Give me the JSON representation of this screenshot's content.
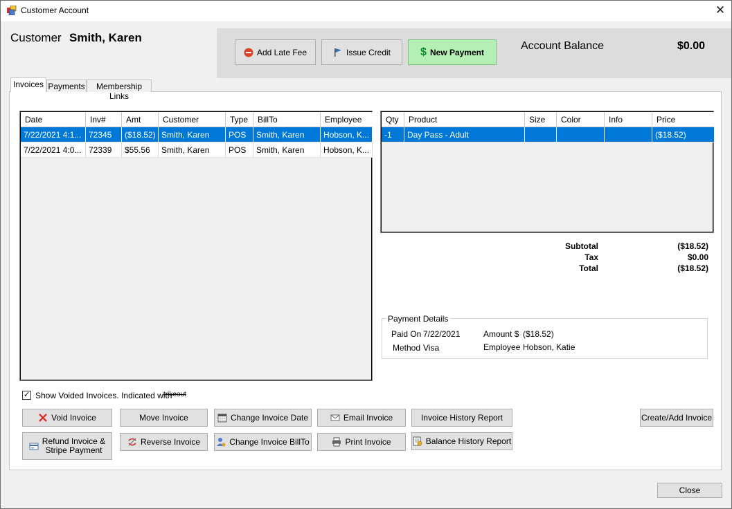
{
  "window": {
    "title": "Customer Account",
    "close_glyph": "✕"
  },
  "customer": {
    "label": "Customer",
    "name": "Smith, Karen"
  },
  "actions": {
    "add_late_fee": "Add Late Fee",
    "issue_credit": "Issue Credit",
    "new_payment": "New Payment"
  },
  "account": {
    "balance_label": "Account Balance",
    "balance_value": "$0.00"
  },
  "tabs": [
    {
      "label": "Invoices",
      "active": true
    },
    {
      "label": "Payments",
      "active": false
    },
    {
      "label": "Membership Links",
      "active": false
    }
  ],
  "invoices": {
    "columns": [
      "Date",
      "Inv#",
      "Amt",
      "Customer",
      "Type",
      "BillTo",
      "Employee"
    ],
    "rows": [
      [
        "7/22/2021 4:1...",
        "72345",
        "($18.52)",
        "Smith, Karen",
        "POS",
        "Smith, Karen",
        "Hobson, K..."
      ],
      [
        "7/22/2021 4:0...",
        "72339",
        "$55.56",
        "Smith, Karen",
        "POS",
        "Smith, Karen",
        "Hobson, K..."
      ]
    ],
    "selected_row": 0
  },
  "items": {
    "columns": [
      "Qty",
      "Product",
      "Size",
      "Color",
      "Info",
      "Price"
    ],
    "rows": [
      [
        "-1",
        "Day Pass - Adult",
        "",
        "",
        "",
        "($18.52)"
      ]
    ],
    "selected_row": 0
  },
  "totals": {
    "subtotal_label": "Subtotal",
    "subtotal": "($18.52)",
    "tax_label": "Tax",
    "tax": "$0.00",
    "total_label": "Total",
    "total": "($18.52)"
  },
  "payment_details": {
    "title": "Payment Details",
    "paid_on_label": "Paid On",
    "paid_on": "7/22/2021",
    "method_label": "Method",
    "method": "Visa",
    "amount_label": "Amount $",
    "amount": "($18.52)",
    "employee_label": "Employee",
    "employee": "Hobson, Katie"
  },
  "show_voided": {
    "checked": true,
    "label": "Show Voided Invoices. Indicated with",
    "strike_text": "trikeout"
  },
  "buttons": {
    "void_invoice": "Void Invoice",
    "refund_invoice": "Refund Invoice &",
    "refund_invoice_2": "Stripe Payment",
    "move_invoice": "Move Invoice",
    "reverse_invoice": "Reverse Invoice",
    "change_invoice_date": "Change Invoice Date",
    "change_invoice_billto": "Change Invoice BillTo",
    "email_invoice": "Email Invoice",
    "print_invoice": "Print Invoice",
    "invoice_history_report": "Invoice History Report",
    "balance_history_report": "Balance History Report",
    "create_add_invoice": "Create/Add Invoice",
    "close": "Close"
  },
  "colors": {
    "selection": "#0078d7",
    "new_payment_bg": "#b4f0b4",
    "dollar_icon": "#0a8a2a"
  }
}
